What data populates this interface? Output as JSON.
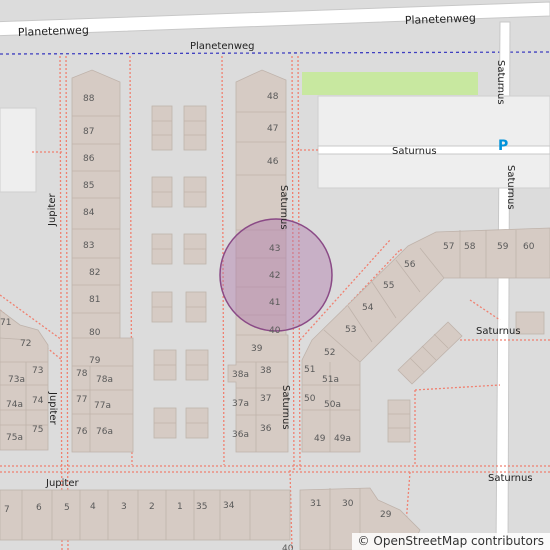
{
  "streets": {
    "planetenweg_main_left": "Planetenweg",
    "planetenweg_main_right": "Planetenweg",
    "planetenweg_path": "Planetenweg",
    "saturnus_east_vertical": "Saturnus",
    "saturnus_east_vertical_2": "Saturnus",
    "saturnus_horizontal_top": "Saturnus",
    "saturnus_mid_vertical": "Saturnus",
    "saturnus_lower_vertical": "Saturnus",
    "saturnus_right_mid": "Saturnus",
    "saturnus_bottom": "Saturnus",
    "jupiter_left_top": "Jupiter",
    "jupiter_left_mid": "Jupiter",
    "jupiter_bottom": "Jupiter"
  },
  "parking_symbol": "P",
  "house_numbers": {
    "west_row": [
      "88",
      "87",
      "86",
      "85",
      "84",
      "83",
      "82",
      "81",
      "80",
      "79",
      "78",
      "78a",
      "77",
      "77a",
      "76",
      "76a"
    ],
    "east_row": [
      "48",
      "47",
      "46",
      "43",
      "42",
      "41",
      "40",
      "39",
      "38a",
      "38",
      "37a",
      "37",
      "36a",
      "36"
    ],
    "far_west": [
      "71",
      "72",
      "73",
      "73a",
      "74",
      "74a",
      "75",
      "75a"
    ],
    "southeast": [
      "57",
      "58",
      "59",
      "60",
      "56",
      "55",
      "54",
      "53",
      "52",
      "51",
      "51a",
      "50",
      "50a",
      "49",
      "49a"
    ],
    "south_row": [
      "7",
      "6",
      "5",
      "4",
      "3",
      "2",
      "1",
      "35",
      "34",
      "31",
      "30",
      "29",
      "40"
    ]
  },
  "highlight_marker": {
    "shape": "circle",
    "color": "#b07bab"
  },
  "colors": {
    "background": "#dcdcdc",
    "building": "#d6cbc4",
    "road": "#ffffff",
    "footpath": "#f08070",
    "grass": "#c8e8a0",
    "boundary": "#4040c0"
  },
  "attribution": {
    "symbol": "©",
    "text": "OpenStreetMap contributors"
  }
}
